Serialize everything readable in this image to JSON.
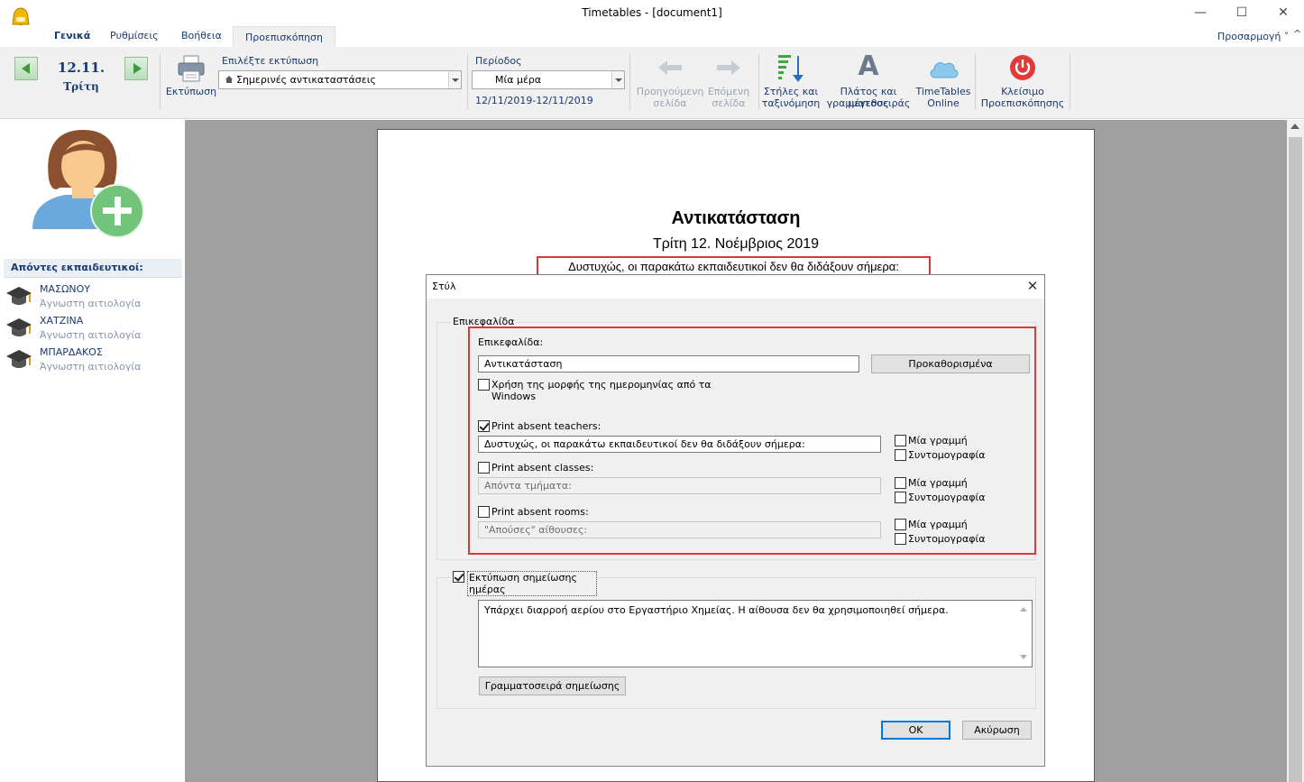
{
  "window": {
    "title": "Timetables - [document1]",
    "minimize": "—",
    "maximize": "☐",
    "close": "✕"
  },
  "tabs": [
    {
      "label": "Γενικά"
    },
    {
      "label": "Ρυθμίσεις"
    },
    {
      "label": "Βοήθεια"
    },
    {
      "label": "Προεπισκόπηση"
    }
  ],
  "adjust_label": "Προσαρμογή",
  "adjust_chevron": "˅",
  "ribbon_collapse": "^",
  "ribbon": {
    "date": "12.11.",
    "day": "Τρίτη",
    "print_label": "Εκτύπωση",
    "choose_print_label": "Επιλέξτε εκτύπωση",
    "choose_print_value": "Σημερινές αντικαταστάσεις",
    "period_label": "Περίοδος",
    "period_value": "Μία μέρα",
    "period_range": "12/11/2019-12/11/2019",
    "prev_page_1": "Προηγούμενη",
    "prev_page_2": "σελίδα",
    "next_page_1": "Επόμενη",
    "next_page_2": "σελίδα",
    "columns_1": "Στήλες και",
    "columns_2": "ταξινόμηση",
    "font_1": "Πλάτος και μέγεθος",
    "font_2": "γραμματοσειράς",
    "font_icon": "A",
    "online_1": "TimeTables",
    "online_2": "Online",
    "close_1": "Κλείσιμο",
    "close_2": "Προεπισκόπησης"
  },
  "left_panel": {
    "absent_header": "Απόντες εκπαιδευτικοί:",
    "teachers": [
      {
        "name": "ΜΑΣΩΝΟΥ",
        "reason": "Άγνωστη αιτιολογία"
      },
      {
        "name": "ΧΑΤΖΙΝΑ",
        "reason": "Άγνωστη αιτιολογία"
      },
      {
        "name": "ΜΠΑΡΔΑΚΟΣ",
        "reason": "Άγνωστη αιτιολογία"
      }
    ]
  },
  "document": {
    "title": "Αντικατάσταση",
    "date": "Τρίτη 12. Νοέμβριος 2019",
    "absent_line": "Δυστυχώς, οι παρακάτω εκπαιδευτικοί δεν θα διδάξουν σήμερα:"
  },
  "dialog": {
    "title": "Στύλ",
    "close": "✕",
    "header_group": "Επικεφαλίδα",
    "header_label": "Επικεφαλίδα:",
    "header_value": "Αντικατάσταση",
    "defaults_button": "Προκαθορισμένα",
    "use_windows_date": "Χρήση της μορφής της ημερομηνίας από τα Windows",
    "use_windows_date_checked": false,
    "print_absent_teachers": "Print absent teachers:",
    "print_absent_teachers_checked": true,
    "absent_teachers_text": "Δυστυχώς, οι παρακάτω εκπαιδευτικοί δεν θα διδάξουν σήμερα:",
    "print_absent_classes": "Print absent classes:",
    "print_absent_classes_checked": false,
    "absent_classes_text": "Απόντα τμήματα:",
    "print_absent_rooms": "Print absent rooms:",
    "print_absent_rooms_checked": false,
    "absent_rooms_text": "\"Απούσες\" αίθουσες:",
    "one_line": "Μία γραμμή",
    "abbreviation": "Συντομογραφία",
    "print_day_note": "Εκτύπωση σημείωσης ημέρας",
    "print_day_note_checked": true,
    "day_note_text": "Υπάρχει διαρροή αερίου στο Εργαστήριο Χημείας. Η αίθουσα δεν θα χρησιμοποιηθεί σήμερα.",
    "note_font_button": "Γραμματοσειρά σημείωσης",
    "ok": "ΟΚ",
    "cancel": "Ακύρωση"
  },
  "colors": {
    "accent_blue": "#1a3a70",
    "highlight_red": "#d9383a",
    "nav_green": "#3c9a3c",
    "close_red": "#e23a3a"
  }
}
